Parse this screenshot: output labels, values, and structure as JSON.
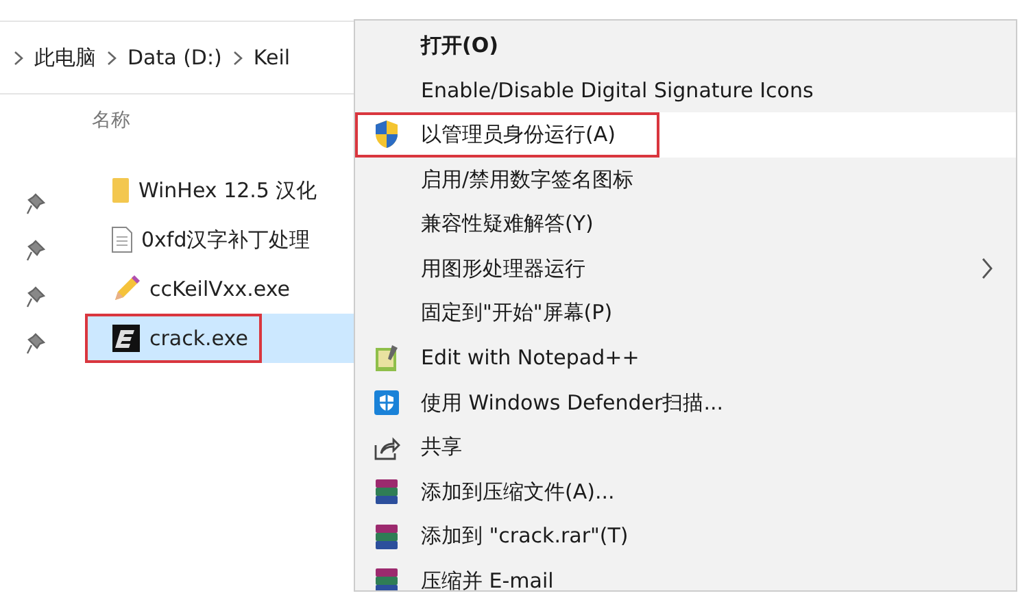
{
  "explorer": {
    "breadcrumb": [
      "此电脑",
      "Data (D:)",
      "Keil"
    ],
    "column_header": "名称",
    "files": [
      {
        "name": "WinHex 12.5 汉化",
        "kind": "folder",
        "selected": false,
        "outlined": false
      },
      {
        "name": "0xfd汉字补丁处理",
        "kind": "document",
        "selected": false,
        "outlined": false
      },
      {
        "name": "ccKeilVxx.exe",
        "kind": "pencil",
        "selected": false,
        "outlined": false
      },
      {
        "name": "crack.exe",
        "kind": "app",
        "selected": true,
        "outlined": true
      }
    ]
  },
  "context_menu": {
    "items": [
      {
        "label": "打开(O)",
        "kind": "plain",
        "bold": true,
        "selected": false,
        "outlined": false,
        "submenu": false
      },
      {
        "label": "Enable/Disable Digital Signature Icons",
        "kind": "plain",
        "bold": false,
        "selected": false,
        "outlined": false,
        "submenu": false
      },
      {
        "label": "以管理员身份运行(A)",
        "kind": "shield",
        "bold": false,
        "selected": true,
        "outlined": true,
        "submenu": false
      },
      {
        "label": "启用/禁用数字签名图标",
        "kind": "plain",
        "bold": false,
        "selected": false,
        "outlined": false,
        "submenu": false
      },
      {
        "label": "兼容性疑难解答(Y)",
        "kind": "plain",
        "bold": false,
        "selected": false,
        "outlined": false,
        "submenu": false
      },
      {
        "label": "用图形处理器运行",
        "kind": "plain",
        "bold": false,
        "selected": false,
        "outlined": false,
        "submenu": true
      },
      {
        "label": "固定到\"开始\"屏幕(P)",
        "kind": "plain",
        "bold": false,
        "selected": false,
        "outlined": false,
        "submenu": false
      },
      {
        "label": "Edit with Notepad++",
        "kind": "notepad",
        "bold": false,
        "selected": false,
        "outlined": false,
        "submenu": false
      },
      {
        "label": "使用 Windows Defender扫描...",
        "kind": "defender",
        "bold": false,
        "selected": false,
        "outlined": false,
        "submenu": false
      },
      {
        "label": "共享",
        "kind": "share",
        "bold": false,
        "selected": false,
        "outlined": false,
        "submenu": false
      },
      {
        "label": "添加到压缩文件(A)...",
        "kind": "archive",
        "bold": false,
        "selected": false,
        "outlined": false,
        "submenu": false
      },
      {
        "label": "添加到 \"crack.rar\"(T)",
        "kind": "archive",
        "bold": false,
        "selected": false,
        "outlined": false,
        "submenu": false
      },
      {
        "label": "压缩并 E-mail",
        "kind": "archive",
        "bold": false,
        "selected": false,
        "outlined": false,
        "submenu": false
      }
    ]
  }
}
